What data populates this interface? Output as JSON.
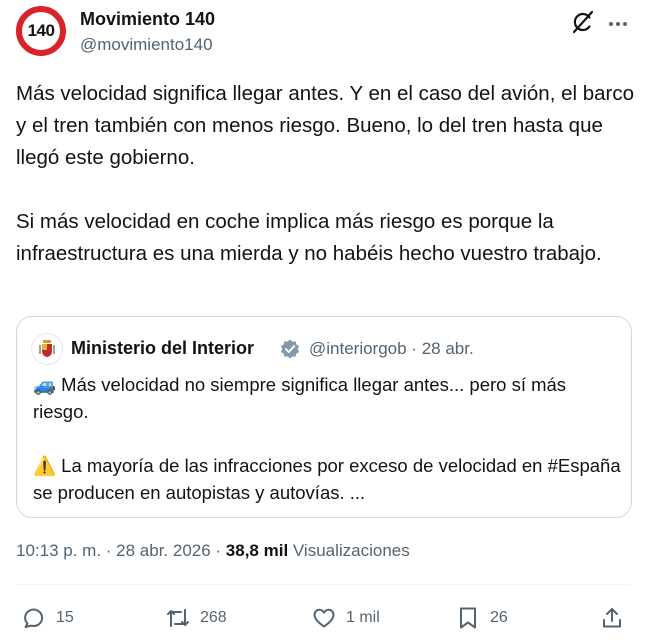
{
  "author": {
    "avatar_text": "140",
    "name": "Movimiento 140",
    "handle": "@movimiento140"
  },
  "tweet": {
    "text": "Más velocidad significa llegar antes. Y en el caso del avión, el barco y el tren también con menos riesgo. Bueno, lo del tren hasta que llegó este gobierno.\n\nSi más velocidad en coche implica más riesgo es porque la infraestructura es una mierda y no habéis hecho vuestro trabajo."
  },
  "quote": {
    "name": "Ministerio del Interior",
    "handle_date": "@interiorgob · 28 abr.",
    "text": "🚙 Más velocidad no siempre significa llegar antes... pero sí más riesgo.\n\n⚠️ La mayoría de las infracciones por exceso de velocidad en #España se producen en autopistas y autovías. ..."
  },
  "meta": {
    "time_date": "10:13 p. m. · 28 abr. 2026 · ",
    "views_count": "38,8 mil",
    "views_label": " Visualizaciones"
  },
  "actions": {
    "replies": "15",
    "reposts": "268",
    "likes": "1 mil",
    "bookmarks": "26"
  },
  "colors": {
    "avatar_ring": "#d8232a",
    "secondary_text": "#536471",
    "verified": "#829aab"
  }
}
